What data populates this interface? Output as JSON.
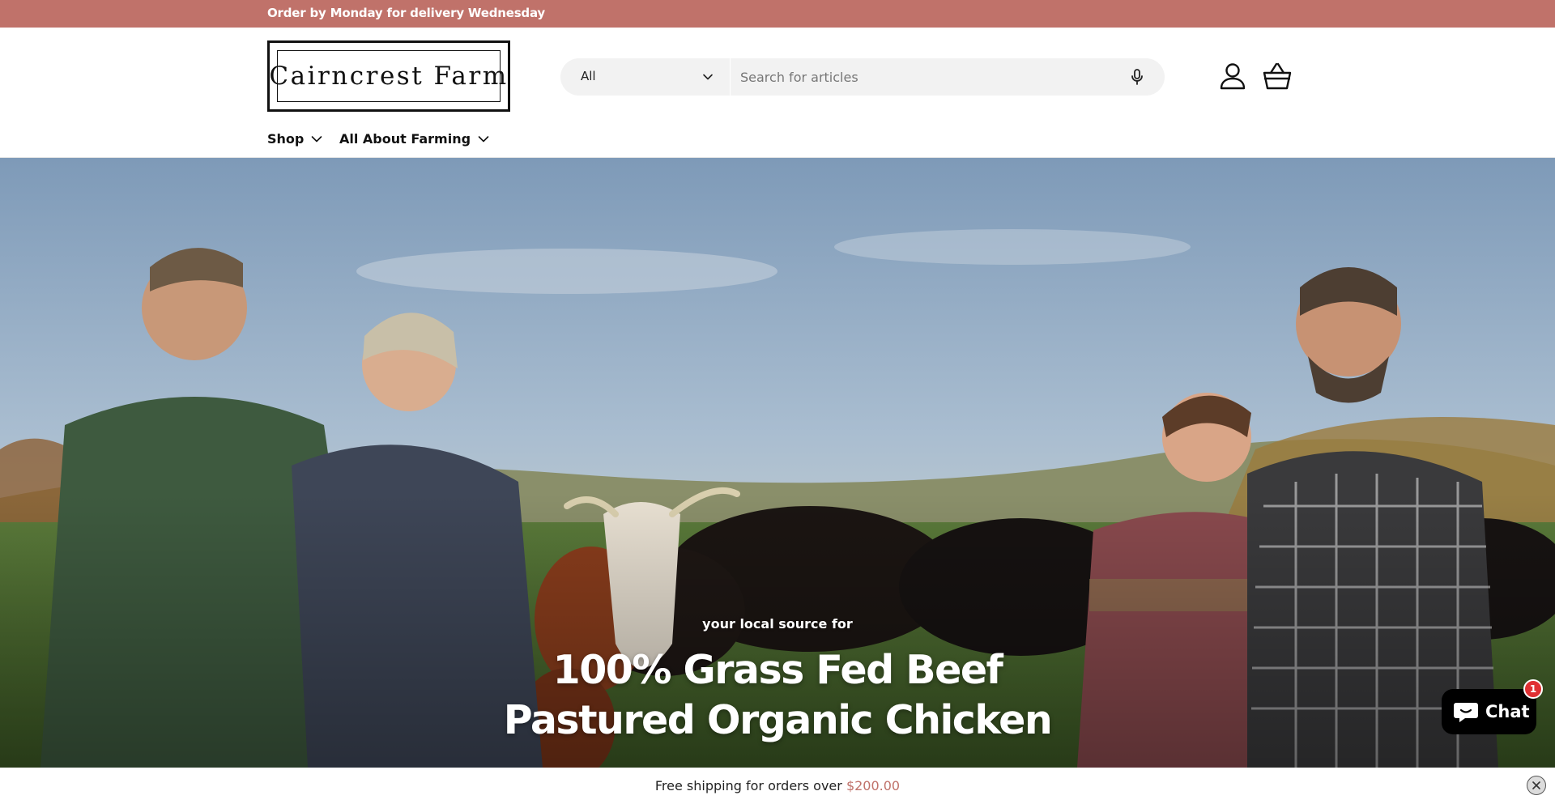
{
  "announcement": {
    "text": "Order by Monday for delivery Wednesday"
  },
  "header": {
    "logo_text": "Cairncrest Farm",
    "search": {
      "category": "All",
      "placeholder": "Search for articles"
    },
    "icons": {
      "account": "account-icon",
      "cart": "basket-icon",
      "voice": "microphone-icon"
    }
  },
  "nav": {
    "items": [
      {
        "label": "Shop"
      },
      {
        "label": "All About Farming"
      }
    ]
  },
  "hero": {
    "subtitle": "your local source for",
    "title_line1": "100% Grass Fed Beef",
    "title_line2": "Pastured Organic Chicken"
  },
  "chat": {
    "label": "Chat",
    "badge": "1"
  },
  "shipping": {
    "prefix": "Free shipping for orders over",
    "amount": "$200.00"
  },
  "colors": {
    "announcement_bg": "#c0726a",
    "accent": "#c0726a",
    "chat_bg": "#000000",
    "badge": "#e03033"
  }
}
